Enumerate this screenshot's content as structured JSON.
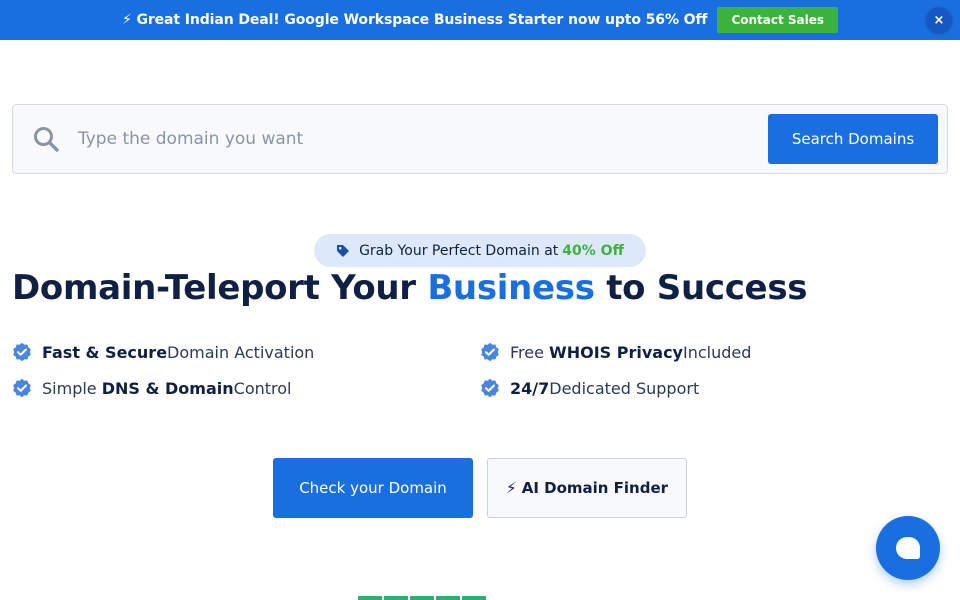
{
  "banner": {
    "text": "⚡ Great Indian Deal! Google Workspace Business Starter now upto 56% Off",
    "cta_label": "Contact Sales",
    "close_label": "×"
  },
  "search": {
    "placeholder": "Type the domain you want",
    "button_label": "Search Domains"
  },
  "promo": {
    "prefix": "Grab Your Perfect Domain at",
    "highlight": "40% Off"
  },
  "headline": {
    "part1": "Domain-Teleport Your ",
    "accent": "Business",
    "part2": " to Success"
  },
  "features": [
    {
      "bold": "Fast & Secure",
      "rest": " Domain Activation"
    },
    {
      "pre": "Free ",
      "bold": "WHOIS Privacy",
      "rest": " Included"
    },
    {
      "pre": "Simple ",
      "bold": "DNS & Domain",
      "rest": " Control"
    },
    {
      "bold": "24/7",
      "rest": " Dedicated Support"
    }
  ],
  "actions": {
    "check_label": "Check your Domain",
    "ai_label": "⚡ AI Domain Finder"
  },
  "rating": {
    "filled": 5,
    "total": 5
  },
  "colors": {
    "brand_blue": "#1a6fe0",
    "accent_green": "#3cb33c",
    "text_dark": "#0f2044"
  },
  "icons": {
    "search": "search-icon",
    "tag": "tag-icon",
    "check": "verified-check-icon",
    "chat": "chat-icon",
    "close": "close-icon"
  }
}
